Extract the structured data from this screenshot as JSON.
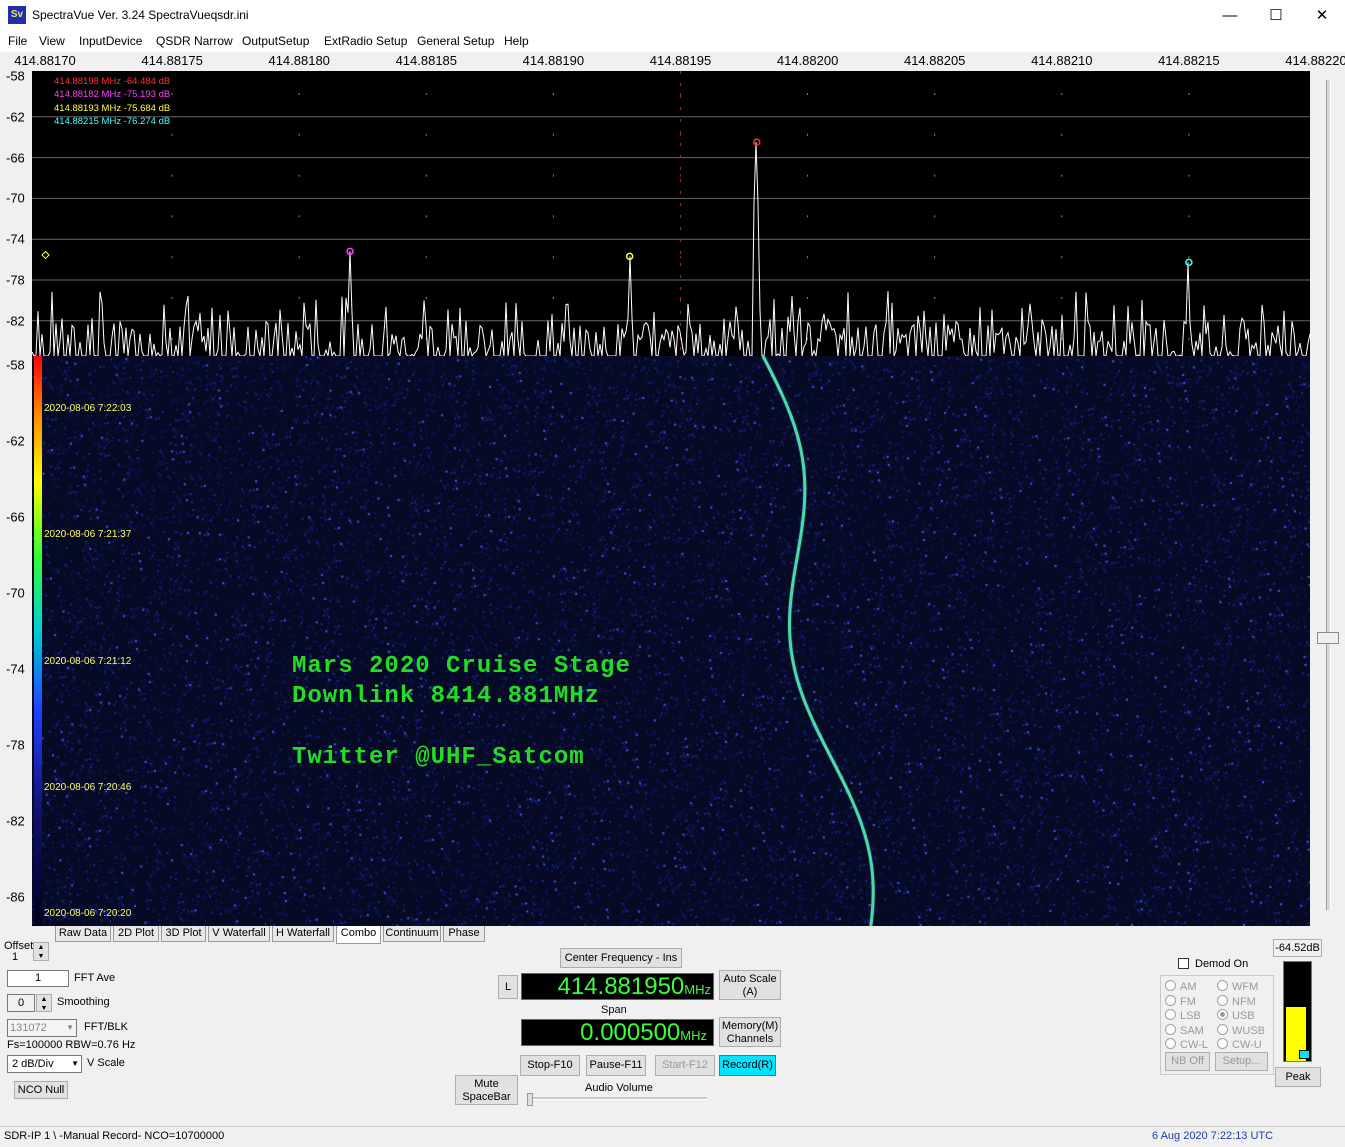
{
  "window": {
    "title": "SpectraVue Ver. 3.24  SpectraVueqsdr.ini",
    "icon_text": "Sv",
    "minimize": "—",
    "maximize": "☐",
    "close": "✕"
  },
  "menu": [
    "File",
    "View",
    "InputDevice",
    "QSDR Narrow",
    "OutputSetup",
    "ExtRadio Setup",
    "General Setup",
    "Help"
  ],
  "freq_axis": [
    "414.88170",
    "414.88175",
    "414.88180",
    "414.88185",
    "414.88190",
    "414.88195",
    "414.88200",
    "414.88205",
    "414.88210",
    "414.88215",
    "414.88220"
  ],
  "spectrum_db_axis": [
    "-58",
    "-62",
    "-66",
    "-70",
    "-74",
    "-78",
    "-82"
  ],
  "waterfall_db_axis": [
    "-58",
    "-62",
    "-66",
    "-70",
    "-74",
    "-78",
    "-82",
    "-86"
  ],
  "markers": [
    {
      "text": "414.88198 MHz -64.484 dB",
      "color": "#ff3030",
      "freq": 414.88198,
      "db": -64.484
    },
    {
      "text": "414.88182 MHz -75.193 dB",
      "color": "#ff40ff",
      "freq": 414.88182,
      "db": -75.193
    },
    {
      "text": "414.88193 MHz -75.684 dB",
      "color": "#ffff40",
      "freq": 414.88193,
      "db": -75.684
    },
    {
      "text": "414.88215 MHz -76.274 dB",
      "color": "#40ffff",
      "freq": 414.88215,
      "db": -76.274
    }
  ],
  "waterfall_times": [
    "2020-08-06 7:22:03",
    "2020-08-06 7:21:37",
    "2020-08-06 7:21:12",
    "2020-08-06 7:20:46",
    "2020-08-06 7:20:20"
  ],
  "overlay": {
    "line1": "Mars 2020 Cruise Stage",
    "line2": "Downlink 8414.881MHz",
    "line3": "Twitter @UHF_Satcom"
  },
  "tabs": [
    "Raw Data",
    "2D Plot",
    "3D Plot",
    "V Waterfall",
    "H Waterfall",
    "Combo",
    "Continuum",
    "Phase"
  ],
  "active_tab": "Combo",
  "controls": {
    "offset_label": "Offset",
    "offset_value": "1",
    "fft_ave_value": "1",
    "fft_ave_label": "FFT Ave",
    "smoothing_value": "0",
    "smoothing_label": "Smoothing",
    "fft_blk_value": "131072",
    "fft_blk_label": "FFT/BLK",
    "fs_rbw": "Fs=100000 RBW=0.76 Hz",
    "vscale_value": "2 dB/Div",
    "vscale_label": "V Scale",
    "nco_null": "NCO Null",
    "center_freq_button": "Center Frequency - Ins",
    "l_button": "L",
    "center_freq_value": "414.881950",
    "mhz": "MHz",
    "auto_scale": "Auto Scale",
    "auto_scale_key": "(A)",
    "span_label": "Span",
    "span_value": "0.000500",
    "memory": "Memory(M)",
    "channels": "Channels",
    "stop": "Stop-F10",
    "pause": "Pause-F11",
    "start": "Start-F12",
    "record": "Record(R)",
    "mute": "Mute",
    "spacebar": "SpaceBar",
    "audio_volume": "Audio Volume",
    "demod_on": "Demod On",
    "modes_left": [
      "AM",
      "FM",
      "LSB",
      "SAM",
      "CW-L"
    ],
    "modes_right": [
      "WFM",
      "NFM",
      "USB",
      "WUSB",
      "CW-U"
    ],
    "selected_mode": "USB",
    "nb_off": "NB Off",
    "setup": "Setup...",
    "level_db": "-64.52dB",
    "level_fraction": 0.55,
    "peak": "Peak"
  },
  "status": {
    "left": "SDR-IP 1  \\ -Manual Record-   NCO=10700000",
    "right": "6 Aug 2020  7:22:13 UTC"
  },
  "colors": {
    "trace": "#ffffff",
    "waterfall_signal": "#66ffcc",
    "overlay_text": "#22dd22",
    "lcd_text": "#39ff39",
    "record_button": "#00e5ff",
    "status_right": "#1a3db0"
  }
}
